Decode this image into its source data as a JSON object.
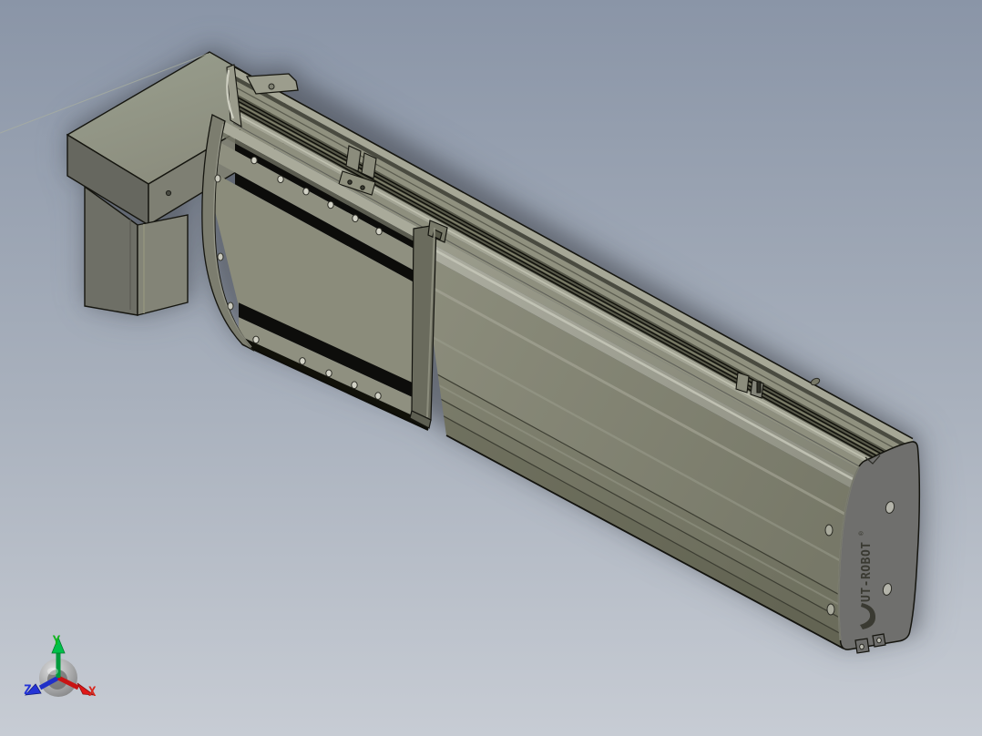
{
  "viewport": {
    "background_top": "#8a95a7",
    "background_bottom": "#c7ccd4",
    "view_type": "isometric"
  },
  "model": {
    "body_color": "#8b8c7b",
    "top_face_color": "#9c9d8d",
    "seal_strip_color": "#0c0c0a",
    "end_plate_color": "#6f6f6d",
    "motor_color": "#7e7f73",
    "edge_color": "#15150f"
  },
  "end_plate": {
    "brand_text": "UT-ROBOT",
    "registered_mark": "®"
  },
  "triad": {
    "x_label": "X",
    "y_label": "Y",
    "z_label": "Z",
    "x_color": "#d8281e",
    "y_color": "#11b41e",
    "z_color": "#2434d6"
  }
}
